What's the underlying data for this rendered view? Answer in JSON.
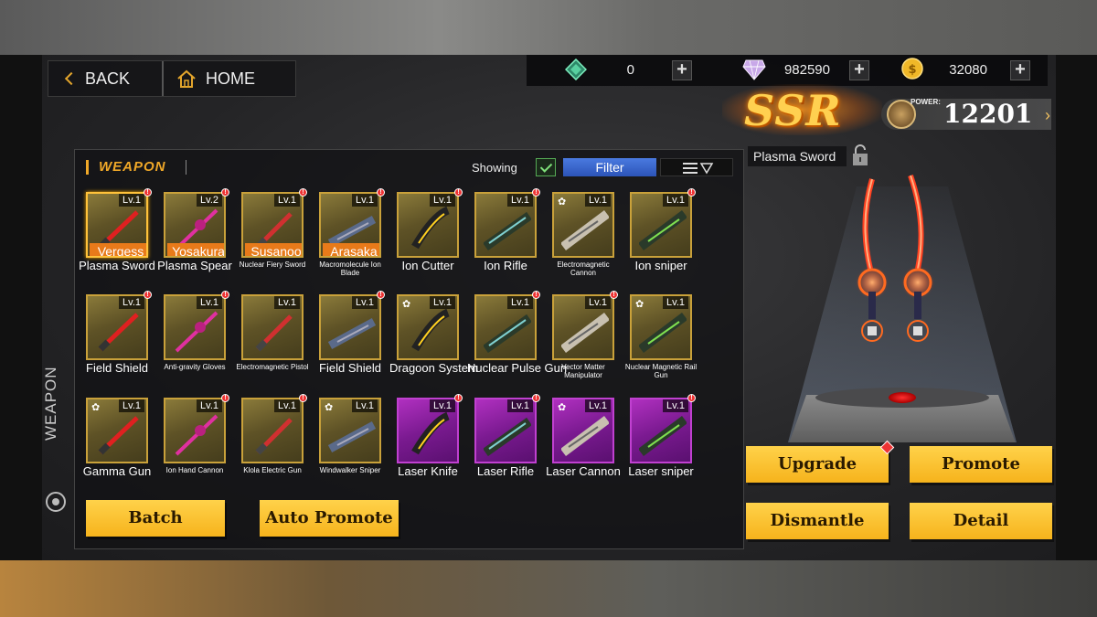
{
  "nav": {
    "back_label": "BACK",
    "home_label": "HOME"
  },
  "resources": [
    {
      "icon": "green-crystal-icon",
      "value": "0",
      "color": "#3fb88a"
    },
    {
      "icon": "diamond-icon",
      "value": "982590",
      "color": "#d8b8f0"
    },
    {
      "icon": "gold-coin-icon",
      "value": "32080",
      "color": "#f0b828"
    }
  ],
  "rarity": "SSR",
  "power": {
    "label": "POWER:",
    "value": "12201"
  },
  "panel": {
    "title": "WEAPON",
    "showing_label": "Showing",
    "filter_label": "Filter"
  },
  "weapons": [
    {
      "name": "Plasma Sword",
      "level": "Lv.1",
      "owner": "Vergess",
      "rarity": "gold",
      "alert": true,
      "selected": true
    },
    {
      "name": "Plasma Spear",
      "level": "Lv.2",
      "owner": "Yosakura",
      "rarity": "gold",
      "alert": true
    },
    {
      "name": "Nuclear Fiery Sword",
      "level": "Lv.1",
      "owner": "Susanoo",
      "rarity": "gold",
      "alert": true,
      "small": true
    },
    {
      "name": "Macromolecule Ion Blade",
      "level": "Lv.1",
      "owner": "Arasaka",
      "rarity": "gold",
      "alert": true,
      "small": true
    },
    {
      "name": "Ion Cutter",
      "level": "Lv.1",
      "rarity": "gold",
      "alert": true
    },
    {
      "name": "Ion Rifle",
      "level": "Lv.1",
      "rarity": "gold",
      "alert": true
    },
    {
      "name": "Electromagnetic Cannon",
      "level": "Lv.1",
      "rarity": "gold",
      "star": true,
      "small": true
    },
    {
      "name": "Ion sniper",
      "level": "Lv.1",
      "rarity": "gold",
      "alert": true
    },
    {
      "name": "Field Shield",
      "level": "Lv.1",
      "rarity": "gold",
      "alert": true
    },
    {
      "name": "Anti-gravity Gloves",
      "level": "Lv.1",
      "rarity": "gold",
      "alert": true,
      "small": true
    },
    {
      "name": "Electromagnetic Pistol",
      "level": "Lv.1",
      "rarity": "gold",
      "small": true
    },
    {
      "name": "Field Shield",
      "level": "Lv.1",
      "rarity": "gold",
      "alert": true
    },
    {
      "name": "Dragoon System",
      "level": "Lv.1",
      "rarity": "gold",
      "star": true
    },
    {
      "name": "Nuclear Pulse Gun",
      "level": "Lv.1",
      "rarity": "gold",
      "alert": true
    },
    {
      "name": "Vector Matter Manipulator",
      "level": "Lv.1",
      "rarity": "gold",
      "alert": true,
      "small": true
    },
    {
      "name": "Nuclear Magnetic Rail Gun",
      "level": "Lv.1",
      "rarity": "gold",
      "star": true,
      "small": true
    },
    {
      "name": "Gamma Gun",
      "level": "Lv.1",
      "rarity": "gold",
      "star": true
    },
    {
      "name": "Ion Hand Cannon",
      "level": "Lv.1",
      "rarity": "gold",
      "alert": true,
      "small": true
    },
    {
      "name": "Klola Electric Gun",
      "level": "Lv.1",
      "rarity": "gold",
      "alert": true,
      "small": true
    },
    {
      "name": "Windwalker Sniper",
      "level": "Lv.1",
      "rarity": "gold",
      "star": true,
      "small": true
    },
    {
      "name": "Laser Knife",
      "level": "Lv.1",
      "rarity": "purple",
      "alert": true
    },
    {
      "name": "Laser Rifle",
      "level": "Lv.1",
      "rarity": "purple",
      "alert": true
    },
    {
      "name": "Laser Cannon",
      "level": "Lv.1",
      "rarity": "purple",
      "star": true
    },
    {
      "name": "Laser sniper",
      "level": "Lv.1",
      "rarity": "purple",
      "alert": true
    }
  ],
  "actions": {
    "batch": "Batch",
    "auto_promote": "Auto Promote",
    "upgrade": "Upgrade",
    "promote": "Promote",
    "dismantle": "Dismantle",
    "detail": "Detail"
  },
  "side_tab": "WEAPON",
  "preview": {
    "weapon_name": "Plasma Sword"
  },
  "colors": {
    "accent": "#f0a828",
    "button": "#f6b31c",
    "filter": "#3a66d0",
    "purple_tile": "#9a2ab0",
    "gold_tile": "#c9a13a",
    "alert": "#e33333"
  }
}
